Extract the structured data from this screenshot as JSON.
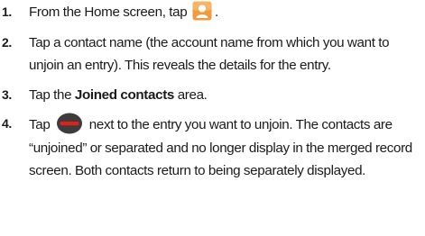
{
  "steps": [
    {
      "number": "1.",
      "text_before": "From the Home screen, tap",
      "icon": "contacts-app-icon",
      "text_after": "."
    },
    {
      "number": "2.",
      "text": "Tap a contact name (the account name from which you want to unjoin an entry). This reveals the details for the entry."
    },
    {
      "number": "3.",
      "text_before": "Tap the",
      "bold": "Joined contacts",
      "text_after": "area."
    },
    {
      "number": "4.",
      "text_before": "Tap",
      "icon": "minus-remove-icon",
      "text_after": "next to the entry you want to unjoin. The contacts are “unjoined” or separated and no longer display in the merged record screen. Both contacts return to being separately displayed."
    }
  ],
  "colors": {
    "contacts_icon": "#f29a3c",
    "remove_icon_circle": "#3c3c3c",
    "remove_icon_bar": "#e0201b"
  }
}
